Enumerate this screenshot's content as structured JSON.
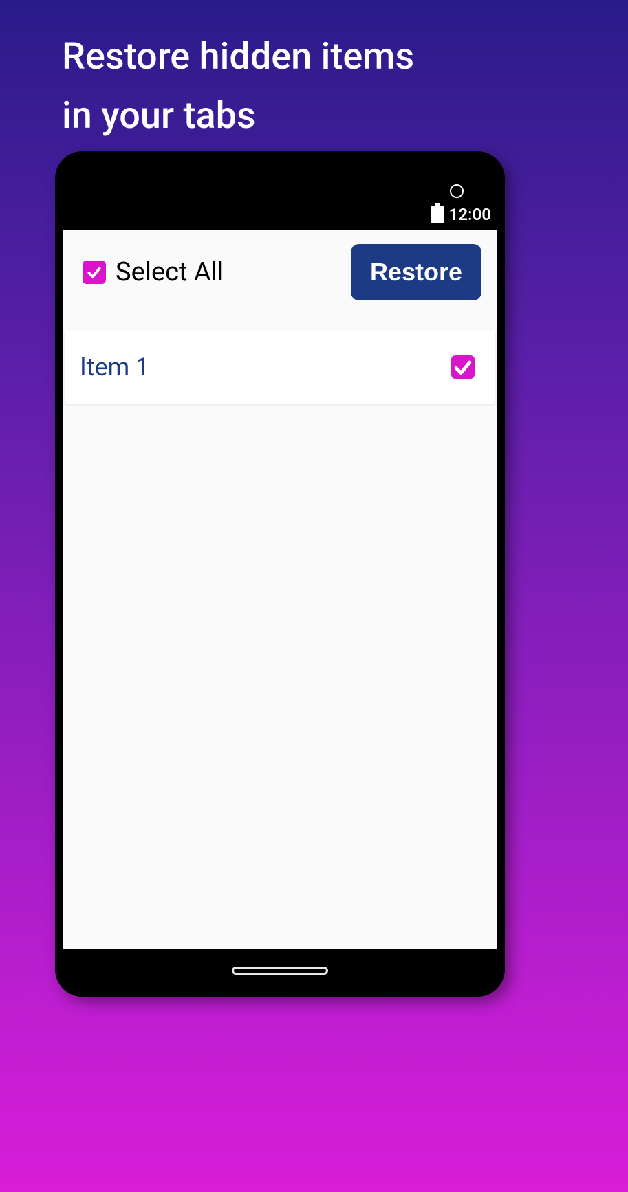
{
  "header": {
    "title_line1": "Restore hidden items",
    "title_line2": "in your tabs"
  },
  "statusBar": {
    "time": "12:00"
  },
  "toolbar": {
    "select_all_label": "Select All",
    "select_all_checked": true,
    "restore_label": "Restore"
  },
  "items": [
    {
      "label": "Item 1",
      "checked": true
    }
  ],
  "colors": {
    "accent_pink": "#d815c8",
    "primary_blue": "#1d3b85",
    "bg_gradient_top": "#2a1b8a",
    "bg_gradient_bottom": "#d91dd9"
  }
}
